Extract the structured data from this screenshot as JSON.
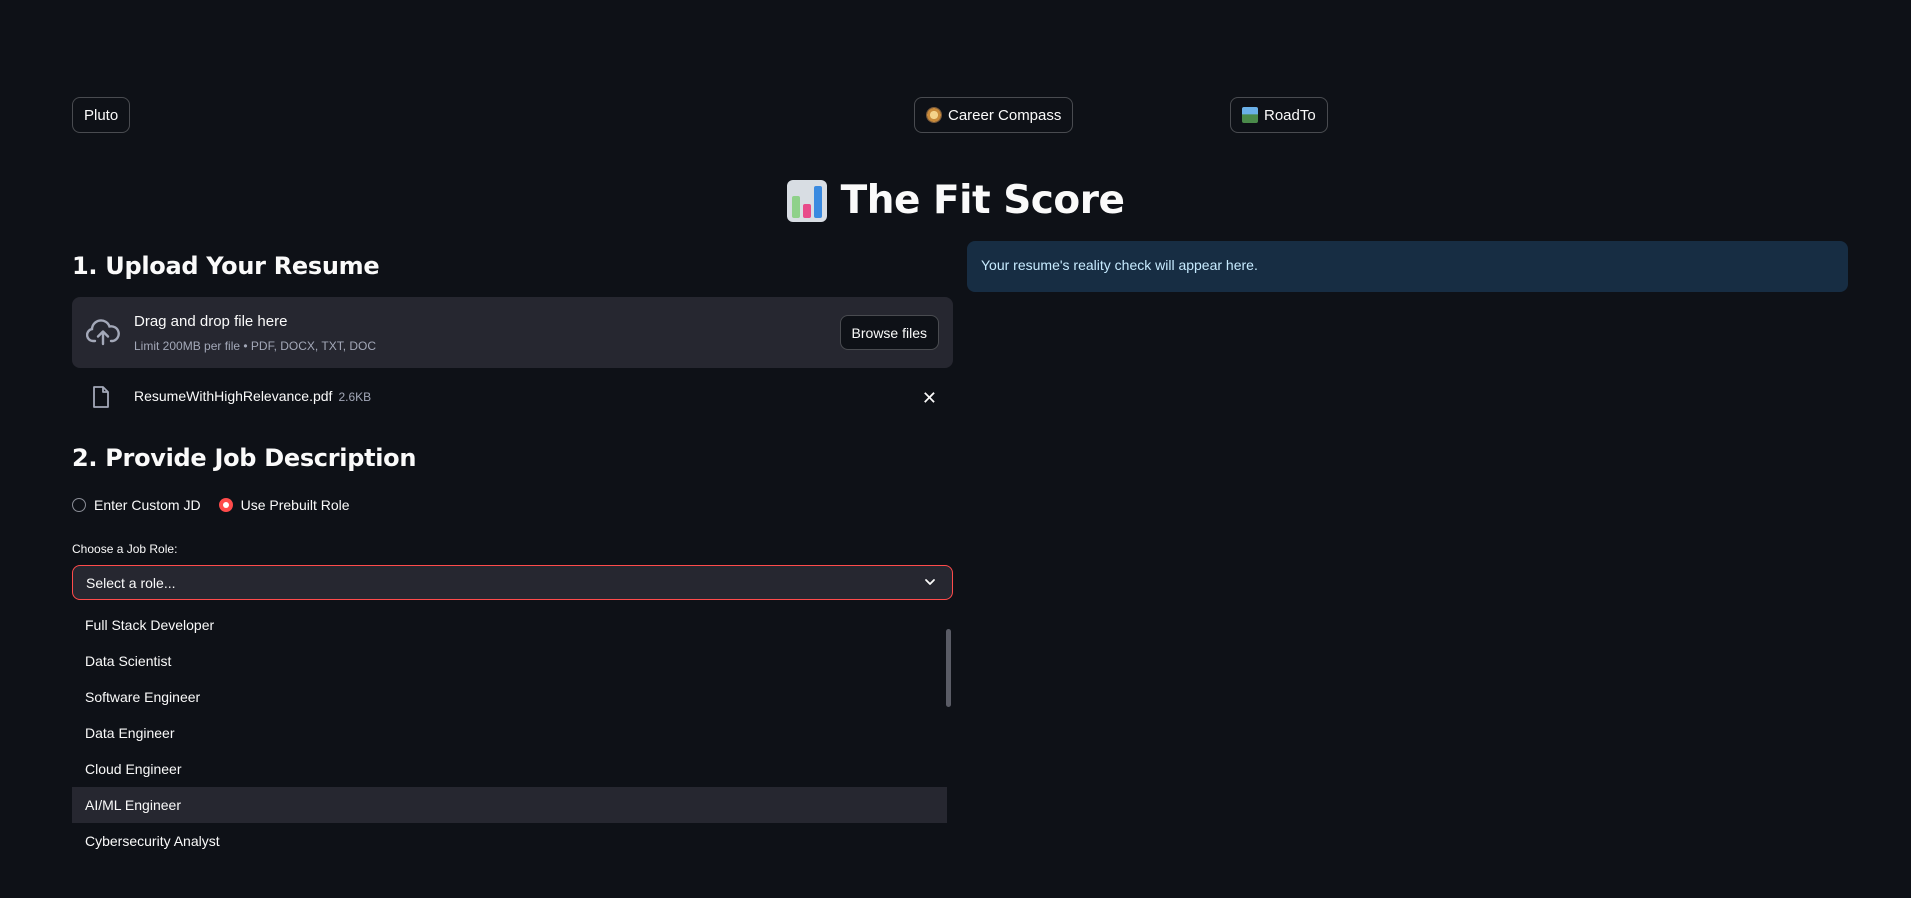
{
  "nav": {
    "pluto_label": "Pluto",
    "career_label": "Career Compass",
    "roadto_label": "RoadTo",
    "career_icon": "compass-icon",
    "roadto_icon": "landscape-icon"
  },
  "title": {
    "text": "The Fit Score",
    "icon": "bar-chart-icon"
  },
  "upload": {
    "heading": "1. Upload Your Resume",
    "drop_text": "Drag and drop file here",
    "limit_text": "Limit 200MB per file • PDF, DOCX, TXT, DOC",
    "browse_label": "Browse files",
    "file": {
      "name": "ResumeWithHighRelevance.pdf",
      "size": "2.6KB"
    }
  },
  "jd": {
    "heading": "2. Provide Job Description",
    "radio_options": [
      "Enter Custom JD",
      "Use Prebuilt Role"
    ],
    "selected_radio": "Use Prebuilt Role",
    "select_label": "Choose a Job Role:",
    "select_placeholder": "Select a role...",
    "options": [
      "Full Stack Developer",
      "Data Scientist",
      "Software Engineer",
      "Data Engineer",
      "Cloud Engineer",
      "AI/ML Engineer",
      "Cybersecurity Analyst"
    ],
    "hovered_option": "AI/ML Engineer"
  },
  "result": {
    "info_text": "Your resume's reality check will appear here."
  },
  "colors": {
    "background": "#0e1117",
    "accent": "#ff4b4b",
    "input_bg": "#262730",
    "info_bg": "#172d43",
    "info_text": "#c7ebff"
  }
}
